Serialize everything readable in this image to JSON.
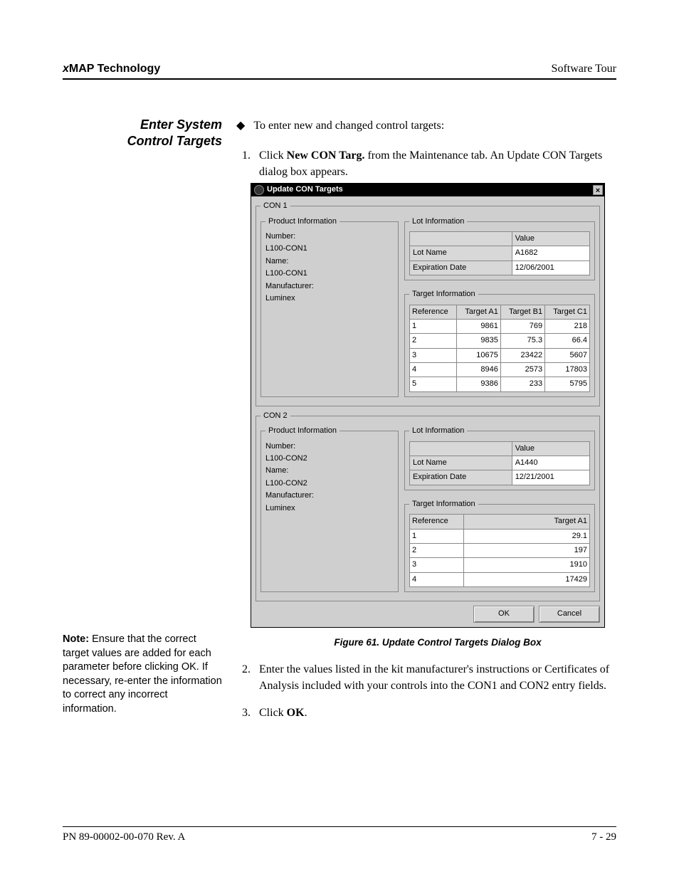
{
  "header": {
    "tech_prefix": "x",
    "tech_text": "MAP Technology",
    "section": "Software Tour"
  },
  "side": {
    "heading_l1": "Enter System",
    "heading_l2": "Control Targets",
    "note_label": "Note:",
    "note_text": " Ensure that the correct target values are added for each parameter before clicking OK. If necessary, re-enter the information to correct any incorrect information."
  },
  "body": {
    "bullet_text": "To enter new and changed control targets:",
    "step1_pre": "Click ",
    "step1_bold": "New CON Targ.",
    "step1_post": " from the Maintenance tab. An Update CON Targets dialog box appears.",
    "step2": "Enter the values listed in the kit manufacturer's instructions or Certificates of Analysis included with your controls into the CON1 and CON2 entry fields.",
    "step3_pre": "Click ",
    "step3_bold": "OK",
    "step3_post": "."
  },
  "dialog": {
    "title": "Update CON Targets",
    "con1": {
      "legend": "CON 1",
      "pi_legend": "Product Information",
      "number_label": "Number:",
      "number_val": "L100-CON1",
      "name_label": "Name:",
      "name_val": "L100-CON1",
      "mfr_label": "Manufacturer:",
      "mfr_val": "Luminex",
      "lot_legend": "Lot Information",
      "lot_value_hdr": "Value",
      "lot_name_label": "Lot Name",
      "lot_name_val": "A1682",
      "lot_exp_label": "Expiration Date",
      "lot_exp_val": "12/06/2001",
      "tgt_legend": "Target Information",
      "tgt_headers": [
        "Reference",
        "Target A1",
        "Target B1",
        "Target C1"
      ],
      "tgt_rows": [
        [
          "1",
          "9861",
          "769",
          "218"
        ],
        [
          "2",
          "9835",
          "75.3",
          "66.4"
        ],
        [
          "3",
          "10675",
          "23422",
          "5607"
        ],
        [
          "4",
          "8946",
          "2573",
          "17803"
        ],
        [
          "5",
          "9386",
          "233",
          "5795"
        ]
      ]
    },
    "con2": {
      "legend": "CON 2",
      "pi_legend": "Product Information",
      "number_label": "Number:",
      "number_val": "L100-CON2",
      "name_label": "Name:",
      "name_val": "L100-CON2",
      "mfr_label": "Manufacturer:",
      "mfr_val": "Luminex",
      "lot_legend": "Lot Information",
      "lot_value_hdr": "Value",
      "lot_name_label": "Lot Name",
      "lot_name_val": "A1440",
      "lot_exp_label": "Expiration Date",
      "lot_exp_val": "12/21/2001",
      "tgt_legend": "Target Information",
      "tgt_headers": [
        "Reference",
        "Target A1"
      ],
      "tgt_rows": [
        [
          "1",
          "29.1"
        ],
        [
          "2",
          "197"
        ],
        [
          "3",
          "1910"
        ],
        [
          "4",
          "17429"
        ]
      ]
    },
    "ok": "OK",
    "cancel": "Cancel"
  },
  "figure_caption": "Figure 61.  Update Control Targets Dialog Box",
  "footer": {
    "left": "PN 89-00002-00-070 Rev. A",
    "right": "7 - 29"
  }
}
